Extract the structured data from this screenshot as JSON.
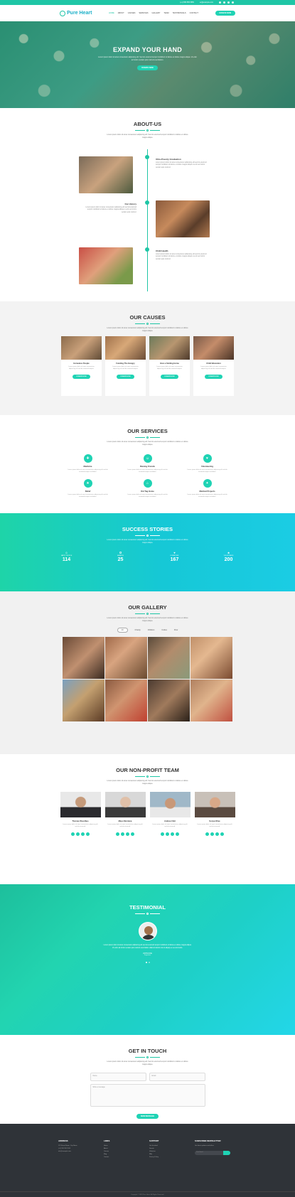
{
  "topbar": {
    "phone": "(+1) 555 555 5555",
    "email": "ex@example.com"
  },
  "nav": {
    "logo": "Pure Heart",
    "items": [
      "HOME",
      "ABOUT",
      "CAUSES",
      "SERVICES",
      "GALLERY",
      "TEAM",
      "TESTIMONIALS",
      "CONTACT"
    ],
    "donate": "DONATE NOW"
  },
  "hero": {
    "title": "EXPAND YOUR HAND",
    "text": "Lorem ipsum dolor sit amet consectetur adipiscing elit. Sed do eiusmod tempor incididunt ut labore et dolore magna aliqua. Ut enim ad minim veniam quis nostrud exercitation.",
    "button": "DONATE NOW"
  },
  "about": {
    "title": "ABOUT-US",
    "desc": "Lorem ipsum dolor sit amet consectetur adipiscing elit. Sed do eiusmod tempor incididunt ut labore et dolore magna aliqua.",
    "items": [
      {
        "title": "Ultra-Poverty Graduation",
        "text": "Lorem ipsum dolor sit amet consectetur adipiscing elit sed do eiusmod tempor incididunt ut labore et dolore magna aliqua ut enim ad minim veniam quis nostrud."
      },
      {
        "title": "Our History",
        "text": "Lorem ipsum dolor sit amet consectetur adipiscing elit sed do eiusmod tempor incididunt ut labore et dolore magna aliqua ut enim ad minim veniam quis nostrud."
      },
      {
        "title": "Child Health",
        "text": "Lorem ipsum dolor sit amet consectetur adipiscing elit sed do eiusmod tempor incididunt ut labore et dolore magna aliqua ut enim ad minim veniam quis nostrud."
      }
    ]
  },
  "causes": {
    "title": "OUR CAUSES",
    "desc": "Lorem ipsum dolor sit amet consectetur adipiscing elit. Sed do eiusmod tempor incididunt ut labore et dolore magna aliqua.",
    "cards": [
      {
        "title": "Homeless People",
        "text": "Lorem ipsum dolor sit amet consectetur adipiscing elit sed do eiusmod tempor.",
        "button": "DONATE NOW"
      },
      {
        "title": "Funding The Hungry",
        "text": "Lorem ipsum dolor sit amet consectetur adipiscing elit sed do eiusmod tempor.",
        "button": "DONATE NOW"
      },
      {
        "title": "Give a Smiling Home",
        "text": "Lorem ipsum dolor sit amet consectetur adipiscing elit sed do eiusmod tempor.",
        "button": "DONATE NOW"
      },
      {
        "title": "Child Education",
        "text": "Lorem ipsum dolor sit amet consectetur adipiscing elit sed do eiusmod tempor.",
        "button": "DONATE NOW"
      }
    ]
  },
  "services": {
    "title": "OUR SERVICES",
    "desc": "Lorem ipsum dolor sit amet consectetur adipiscing elit. Sed do eiusmod tempor incididunt ut labore et dolore magna aliqua.",
    "items": [
      {
        "title": "Medicine",
        "text": "Lorem ipsum dolor sit amet consectetur adipiscing elit sed do eiusmod tempor incididunt."
      },
      {
        "title": "Raising Friends",
        "text": "Lorem ipsum dolor sit amet consectetur adipiscing elit sed do eiusmod tempor incididunt."
      },
      {
        "title": "Volunteering",
        "text": "Lorem ipsum dolor sit amet consectetur adipiscing elit sed do eiusmod tempor incididunt."
      },
      {
        "title": "Relief",
        "text": "Lorem ipsum dolor sit amet consectetur adipiscing elit sed do eiusmod tempor incididunt."
      },
      {
        "title": "Kid Tag Home",
        "text": "Lorem ipsum dolor sit amet consectetur adipiscing elit sed do eiusmod tempor incididunt."
      },
      {
        "title": "Medical Projects",
        "text": "Lorem ipsum dolor sit amet consectetur adipiscing elit sed do eiusmod tempor incididunt."
      }
    ]
  },
  "stories": {
    "title": "SUCCESS STORIES",
    "desc": "Lorem ipsum dolor sit amet consectetur adipiscing elit. Sed do eiusmod tempor incididunt ut labore et dolore magna aliqua.",
    "counters": [
      {
        "label": "HAPPY PEOPLE",
        "value": "114"
      },
      {
        "label": "AWARDS",
        "value": "25"
      },
      {
        "label": "DONATIONS",
        "value": "167"
      },
      {
        "label": "VOLUNTEERS",
        "value": "200"
      }
    ]
  },
  "gallery": {
    "title": "OUR GALLERY",
    "desc": "Lorem ipsum dolor sit amet consectetur adipiscing elit. Sed do eiusmod tempor incididunt ut labore et dolore magna aliqua.",
    "filters": [
      "All",
      "Charity",
      "Children",
      "Cubes",
      "Poor"
    ]
  },
  "team": {
    "title": "OUR NON-PROFIT TEAM",
    "desc": "Lorem ipsum dolor sit amet consectetur adipiscing elit. Sed do eiusmod tempor incididunt ut labore et dolore magna aliqua.",
    "members": [
      {
        "name": "Thomas Woodbus",
        "text": "Lorem ipsum dolor sit amet consectetur adipiscing elit sed do eiusmod."
      },
      {
        "name": "Mayo Montana",
        "text": "Lorem ipsum dolor sit amet consectetur adipiscing elit sed do eiusmod."
      },
      {
        "name": "Andrea Clint",
        "text": "Lorem ipsum dolor sit amet consectetur adipiscing elit sed do eiusmod."
      },
      {
        "name": "Sonya Olive",
        "text": "Lorem ipsum dolor sit amet consectetur adipiscing elit sed do eiusmod."
      }
    ]
  },
  "testimonial": {
    "title": "TESTIMONIAL",
    "quote": "Lorem ipsum dolor sit amet consectetur adipiscing elit sed do eiusmod tempor incididunt ut labore et dolore magna aliqua. Ut enim ad minim veniam quis nostrud exercitation ullamco laboris nisi ut aliquip ex ea commodo.",
    "name": "JOHN DOE",
    "role": "Supporter"
  },
  "contact": {
    "title": "GET IN TOUCH",
    "desc": "Lorem ipsum dolor sit amet consectetur adipiscing elit. Sed do eiusmod tempor incididunt ut labore et dolore magna aliqua.",
    "name_ph": "Name",
    "email_ph": "Email",
    "message_ph": "Write a message",
    "button": "SEND MESSAGE"
  },
  "footer": {
    "address": {
      "title": "ADDRESS",
      "lines": [
        "123 Street Name, City Name",
        "(+1) 555 555 5555",
        "info@example.com"
      ]
    },
    "links": {
      "title": "LINKS",
      "lines": [
        "Home",
        "About",
        "Causes",
        "Blog",
        "Contact"
      ]
    },
    "support": {
      "title": "SUPPORT",
      "lines": [
        "Get Involved",
        "Donate",
        "Volunteer",
        "FAQ",
        "Privacy Policy"
      ]
    },
    "newsletter": {
      "title": "SUBSCRIBE NEWSLETTER",
      "text": "Get latest updates and offers.",
      "placeholder": "Your Email"
    },
    "copyright": "Copyright © 2018 Pure Heart. All Rights Reserved."
  }
}
